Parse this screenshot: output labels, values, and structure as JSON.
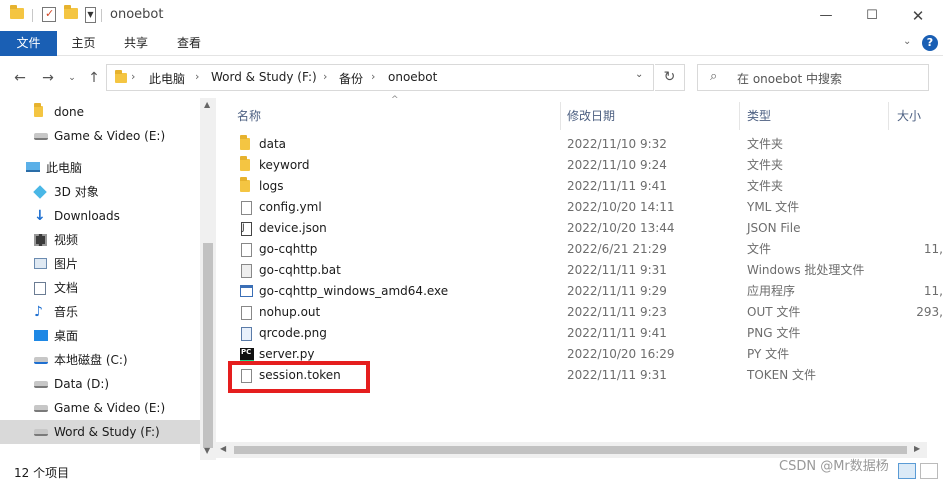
{
  "window": {
    "title": "onoebot"
  },
  "ribbon": {
    "tabs": [
      "文件",
      "主页",
      "共享",
      "查看"
    ]
  },
  "address": {
    "crumbs": [
      "此电脑",
      "Word & Study (F:)",
      "备份",
      "onoebot"
    ],
    "search_placeholder": "在 onoebot 中搜索"
  },
  "nav": {
    "items": [
      {
        "label": "done",
        "icon": "folder-icon"
      },
      {
        "label": "Game & Video (E:)",
        "icon": "drive-icon"
      },
      {
        "label": "此电脑",
        "icon": "computer-icon"
      },
      {
        "label": "3D 对象",
        "icon": "3d-objects-icon"
      },
      {
        "label": "Downloads",
        "icon": "download-icon"
      },
      {
        "label": "视频",
        "icon": "video-icon"
      },
      {
        "label": "图片",
        "icon": "pictures-icon"
      },
      {
        "label": "文档",
        "icon": "documents-icon"
      },
      {
        "label": "音乐",
        "icon": "music-icon"
      },
      {
        "label": "桌面",
        "icon": "desktop-icon"
      },
      {
        "label": "本地磁盘 (C:)",
        "icon": "system-drive-icon"
      },
      {
        "label": "Data (D:)",
        "icon": "drive-icon"
      },
      {
        "label": "Game & Video (E:)",
        "icon": "drive-icon"
      },
      {
        "label": "Word & Study (F:)",
        "icon": "drive-icon"
      }
    ]
  },
  "columns": {
    "name": "名称",
    "date": "修改日期",
    "type": "类型",
    "size": "大小"
  },
  "files": [
    {
      "name": "data",
      "date": "2022/11/10 9:32",
      "type": "文件夹",
      "size": "",
      "icon": "folder-icon"
    },
    {
      "name": "keyword",
      "date": "2022/11/10 9:24",
      "type": "文件夹",
      "size": "",
      "icon": "folder-icon"
    },
    {
      "name": "logs",
      "date": "2022/11/11 9:41",
      "type": "文件夹",
      "size": "",
      "icon": "folder-icon"
    },
    {
      "name": "config.yml",
      "date": "2022/10/20 14:11",
      "type": "YML 文件",
      "size": "",
      "icon": "file-icon"
    },
    {
      "name": "device.json",
      "date": "2022/10/20 13:44",
      "type": "JSON File",
      "size": "",
      "icon": "json-file-icon"
    },
    {
      "name": "go-cqhttp",
      "date": "2022/6/21 21:29",
      "type": "文件",
      "size": "11,",
      "icon": "file-icon"
    },
    {
      "name": "go-cqhttp.bat",
      "date": "2022/11/11 9:31",
      "type": "Windows 批处理文件",
      "size": "",
      "icon": "batch-file-icon"
    },
    {
      "name": "go-cqhttp_windows_amd64.exe",
      "date": "2022/11/11 9:29",
      "type": "应用程序",
      "size": "11,",
      "icon": "exe-icon"
    },
    {
      "name": "nohup.out",
      "date": "2022/11/11 9:23",
      "type": "OUT 文件",
      "size": "293,",
      "icon": "file-icon"
    },
    {
      "name": "qrcode.png",
      "date": "2022/11/11 9:41",
      "type": "PNG 文件",
      "size": "",
      "icon": "image-file-icon"
    },
    {
      "name": "server.py",
      "date": "2022/10/20 16:29",
      "type": "PY 文件",
      "size": "",
      "icon": "pycharm-icon"
    },
    {
      "name": "session.token",
      "date": "2022/11/11 9:31",
      "type": "TOKEN 文件",
      "size": "",
      "icon": "file-icon"
    }
  ],
  "status": {
    "count": "12 个项目"
  },
  "watermark": "CSDN @Mr数据杨",
  "colors": {
    "accent": "#1a5fb4",
    "highlight": "#e51e1e",
    "folder": "#f4c542"
  }
}
